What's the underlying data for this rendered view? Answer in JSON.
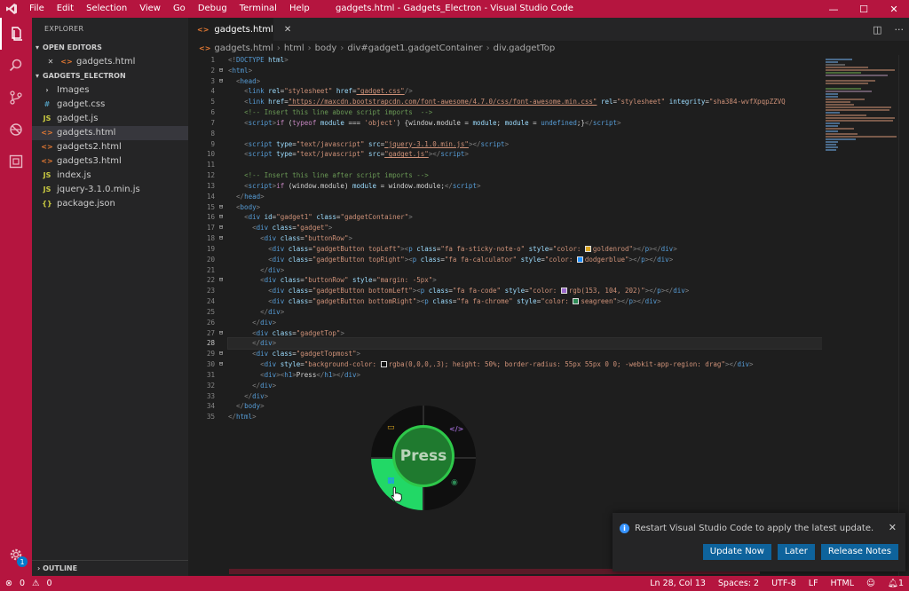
{
  "window": {
    "title": "gadgets.html - Gadgets_Electron - Visual Studio Code",
    "menu": [
      "File",
      "Edit",
      "Selection",
      "View",
      "Go",
      "Debug",
      "Terminal",
      "Help"
    ],
    "controls": {
      "minimize": "—",
      "maximize": "☐",
      "close": "✕"
    }
  },
  "activity_badge": "1",
  "sidebar": {
    "title": "EXPLORER",
    "open_editors_header": "OPEN EDITORS",
    "open_editors": [
      {
        "label": "gadgets.html",
        "close": "✕",
        "icon": "<>"
      }
    ],
    "folder_header": "GADGETS_ELECTRON",
    "files": [
      {
        "label": "Images",
        "icon": "›",
        "type": "folder"
      },
      {
        "label": "gadget.css",
        "icon": "#",
        "type": "css"
      },
      {
        "label": "gadget.js",
        "icon": "JS",
        "type": "js"
      },
      {
        "label": "gadgets.html",
        "icon": "<>",
        "type": "html",
        "selected": true
      },
      {
        "label": "gadgets2.html",
        "icon": "<>",
        "type": "html"
      },
      {
        "label": "gadgets3.html",
        "icon": "<>",
        "type": "html"
      },
      {
        "label": "index.js",
        "icon": "JS",
        "type": "js"
      },
      {
        "label": "jquery-3.1.0.min.js",
        "icon": "JS",
        "type": "js"
      },
      {
        "label": "package.json",
        "icon": "{}",
        "type": "json"
      }
    ],
    "outline_header": "OUTLINE"
  },
  "editor": {
    "tab_label": "gadgets.html",
    "tab_close": "✕",
    "breadcrumbs": [
      "gadgets.html",
      "html",
      "body",
      "div#gadget1.gadgetContainer",
      "div.gadgetTop"
    ],
    "current_line": 28,
    "line_numbers": [
      "1",
      "2",
      "3",
      "4",
      "5",
      "6",
      "7",
      "8",
      "9",
      "10",
      "11",
      "12",
      "13",
      "14",
      "15",
      "16",
      "17",
      "18",
      "19",
      "20",
      "21",
      "22",
      "23",
      "24",
      "25",
      "26",
      "27",
      "28",
      "29",
      "30",
      "31",
      "32",
      "33",
      "34",
      "35"
    ]
  },
  "gadget": {
    "press_label": "Press",
    "icon_tl": "▭",
    "icon_tr": "</>",
    "icon_bl": "▦",
    "icon_br": "◉"
  },
  "notification": {
    "message": "Restart Visual Studio Code to apply the latest update.",
    "info_icon": "i",
    "close": "✕",
    "buttons": [
      "Update Now",
      "Later",
      "Release Notes"
    ]
  },
  "status": {
    "errors": "0",
    "warnings": "0",
    "position": "Ln 28, Col 13",
    "spaces": "Spaces: 2",
    "encoding": "UTF-8",
    "eol": "LF",
    "language": "HTML",
    "bell_count": "1"
  },
  "colors": {
    "accent": "#b5153f",
    "editor_bg": "#1e1e1e",
    "button": "#0e639c",
    "gadget_green": "#22d866"
  }
}
